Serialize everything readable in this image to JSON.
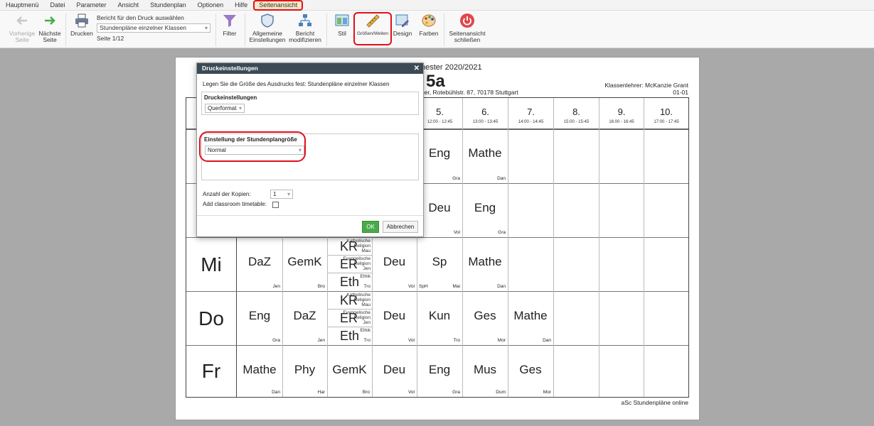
{
  "menu": [
    "Hauptmenü",
    "Datei",
    "Parameter",
    "Ansicht",
    "Stundenplan",
    "Optionen",
    "Hilfe",
    "Seitenansicht"
  ],
  "ribbon": {
    "prev": "Vorherige Seite",
    "next": "Nächste Seite",
    "print": "Drucken",
    "report_label": "Bericht für den Druck auswählen",
    "report_value": "Stundenpläne einzelner Klassen",
    "page": "Seite 1/12",
    "filter": "Filter",
    "general": "Allgemeine Einstellungen",
    "modify": "Bericht modifizieren",
    "style": "Stil",
    "sizes": "Größen/Weiten",
    "design": "Design",
    "colors": "Farben",
    "close": "Seitenansicht schließen"
  },
  "page": {
    "title_part": "nester 2020/2021",
    "class": "5a",
    "address": "ger, Rotebühlstr. 87, 70178 Stuttgart",
    "teacher": "Klassenlehrer: McKanzie Grant",
    "room": "01-01",
    "footer": "aSc Stundenpläne online"
  },
  "periods": [
    {
      "n": "5.",
      "t": "12:00 - 12:45"
    },
    {
      "n": "6.",
      "t": "13:00 - 13:45"
    },
    {
      "n": "7.",
      "t": "14:00 - 14:45"
    },
    {
      "n": "8.",
      "t": "15:00 - 15:45"
    },
    {
      "n": "9.",
      "t": "16:00 - 16:45"
    },
    {
      "n": "10.",
      "t": "17:00 - 17:45"
    }
  ],
  "days": [
    "Mi",
    "Do",
    "Fr"
  ],
  "lessons": {
    "r0": [
      {
        "s": "Eng",
        "t": "Gra"
      },
      {
        "s": "Mathe",
        "t": "Dan"
      }
    ],
    "r1": [
      {
        "s": "Deu",
        "t": "Vol"
      },
      {
        "s": "Eng",
        "t": "Gra"
      }
    ],
    "mi": [
      {
        "s": "DaZ",
        "t": "Jen"
      },
      {
        "s": "GemK",
        "t": "Bro"
      },
      {
        "s": "Deu",
        "t": "Vol"
      },
      {
        "s": "Sp",
        "t": "Mai",
        "l": "SpH"
      },
      {
        "s": "Mathe",
        "t": "Dan"
      }
    ],
    "do": [
      {
        "s": "Eng",
        "t": "Gra"
      },
      {
        "s": "DaZ",
        "t": "Jen"
      },
      {
        "s": "Deu",
        "t": "Vol"
      },
      {
        "s": "Kun",
        "t": "Tro"
      },
      {
        "s": "Ges",
        "t": "Mor"
      },
      {
        "s": "Mathe",
        "t": "Dan"
      }
    ],
    "fr": [
      {
        "s": "Mathe",
        "t": "Dan"
      },
      {
        "s": "Phy",
        "t": "Har"
      },
      {
        "s": "GemK",
        "t": "Bro"
      },
      {
        "s": "Deu",
        "t": "Vol"
      },
      {
        "s": "Eng",
        "t": "Gra"
      },
      {
        "s": "Mus",
        "t": "Dum"
      },
      {
        "s": "Ges",
        "t": "Mor"
      }
    ]
  },
  "religion": {
    "kr": "KR",
    "kr_d1": "Katholische",
    "kr_d2": "Religion",
    "kr_t": "Mau",
    "er": "ER",
    "er_d1": "Evangelische",
    "er_d2": "Religion",
    "er_t": "Jen",
    "eth": "Eth",
    "eth_d": "Ethik",
    "eth_t": "Tro"
  },
  "dialog": {
    "title": "Druckeinstellungen",
    "text": "Legen Sie die Größe des Ausdrucks fest: Stundenpläne einzelner Klassen",
    "group1": "Druckeinstellungen",
    "orientation": "Querformat",
    "group2": "Einstellung der Stundenplangröße",
    "size": "Normal",
    "copies_label": "Anzahl der Kopien:",
    "copies": "1",
    "classroom_label": "Add classroom timetable:",
    "ok": "OK",
    "cancel": "Abbrechen"
  }
}
